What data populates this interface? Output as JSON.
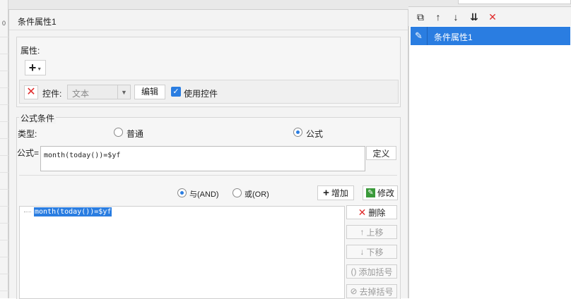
{
  "background": {
    "left_marker": "0"
  },
  "dialog": {
    "title": "条件属性1",
    "properties_section": {
      "label": "属性:",
      "add_button_icon": "plus-icon",
      "control_label": "控件:",
      "control_value": "文本",
      "edit_label": "编辑",
      "use_control_label": "使用控件",
      "use_control_checked": true
    },
    "formula_section": {
      "label": "公式条件",
      "type_label": "类型:",
      "type_options": [
        "普通",
        "公式"
      ],
      "type_selected": "公式",
      "formula_label": "公式=",
      "formula_value": "month(today())=$yf",
      "define_label": "定义",
      "logic_options": [
        "与(AND)",
        "或(OR)"
      ],
      "logic_selected": "与(AND)",
      "add_label": "增加",
      "modify_label": "修改",
      "condition_items": [
        "month(today())=$yf"
      ],
      "side_buttons": {
        "delete": "删除",
        "move_up": "上移",
        "move_down": "下移",
        "add_parens": "添加括号",
        "remove_parens": "去掉括号"
      }
    }
  },
  "right_panel": {
    "toolbar_icons": [
      "copy-icon",
      "arrow-up-icon",
      "arrow-down-icon",
      "move-bottom-icon",
      "close-icon"
    ],
    "items": [
      "条件属性1"
    ],
    "colors": {
      "selection": "#2a7de1",
      "delete": "#e02b2b"
    }
  }
}
